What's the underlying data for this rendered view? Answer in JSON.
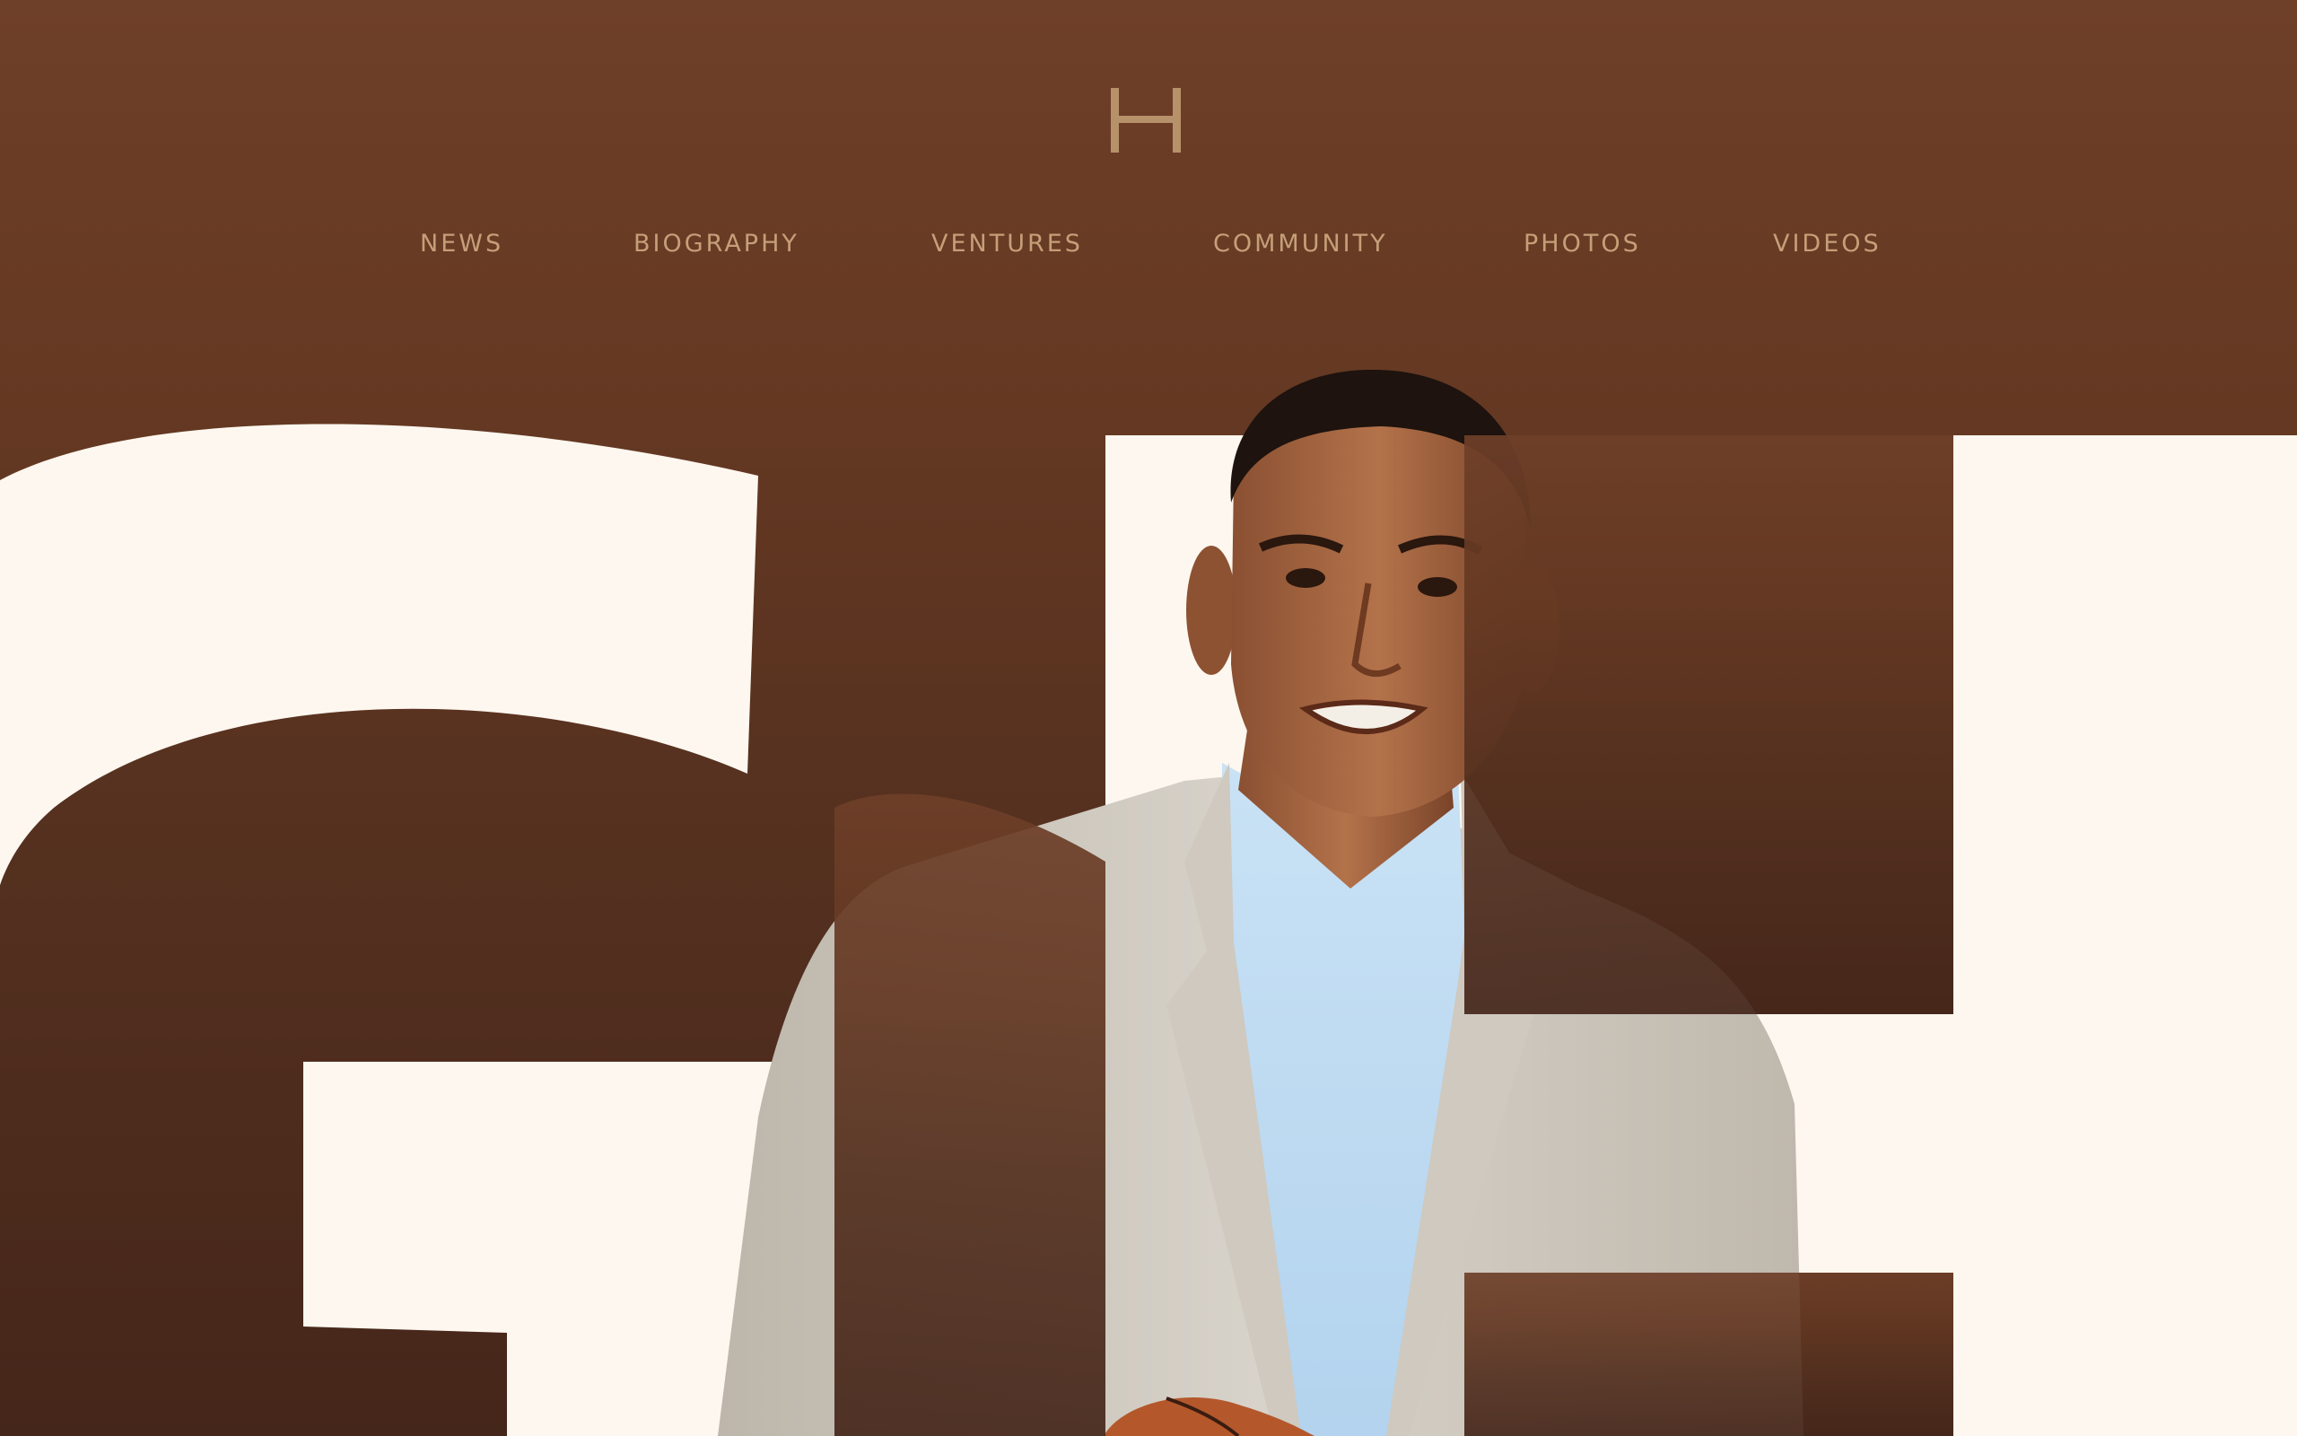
{
  "site": {
    "logo_letter": "H",
    "hero_monogram": "GH"
  },
  "nav": {
    "items": [
      {
        "label": "NEWS"
      },
      {
        "label": "BIOGRAPHY"
      },
      {
        "label": "VENTURES"
      },
      {
        "label": "COMMUNITY"
      },
      {
        "label": "PHOTOS"
      },
      {
        "label": "VIDEOS"
      }
    ]
  },
  "colors": {
    "background_top": "#6e3f29",
    "background_bottom": "#45261a",
    "cream": "#fdf7ef",
    "nav_text": "#c59f78",
    "logo": "#b7916a"
  },
  "hero": {
    "image": "portrait of a smiling man in a light grey suit jacket and blue shirt holding a basketball"
  }
}
